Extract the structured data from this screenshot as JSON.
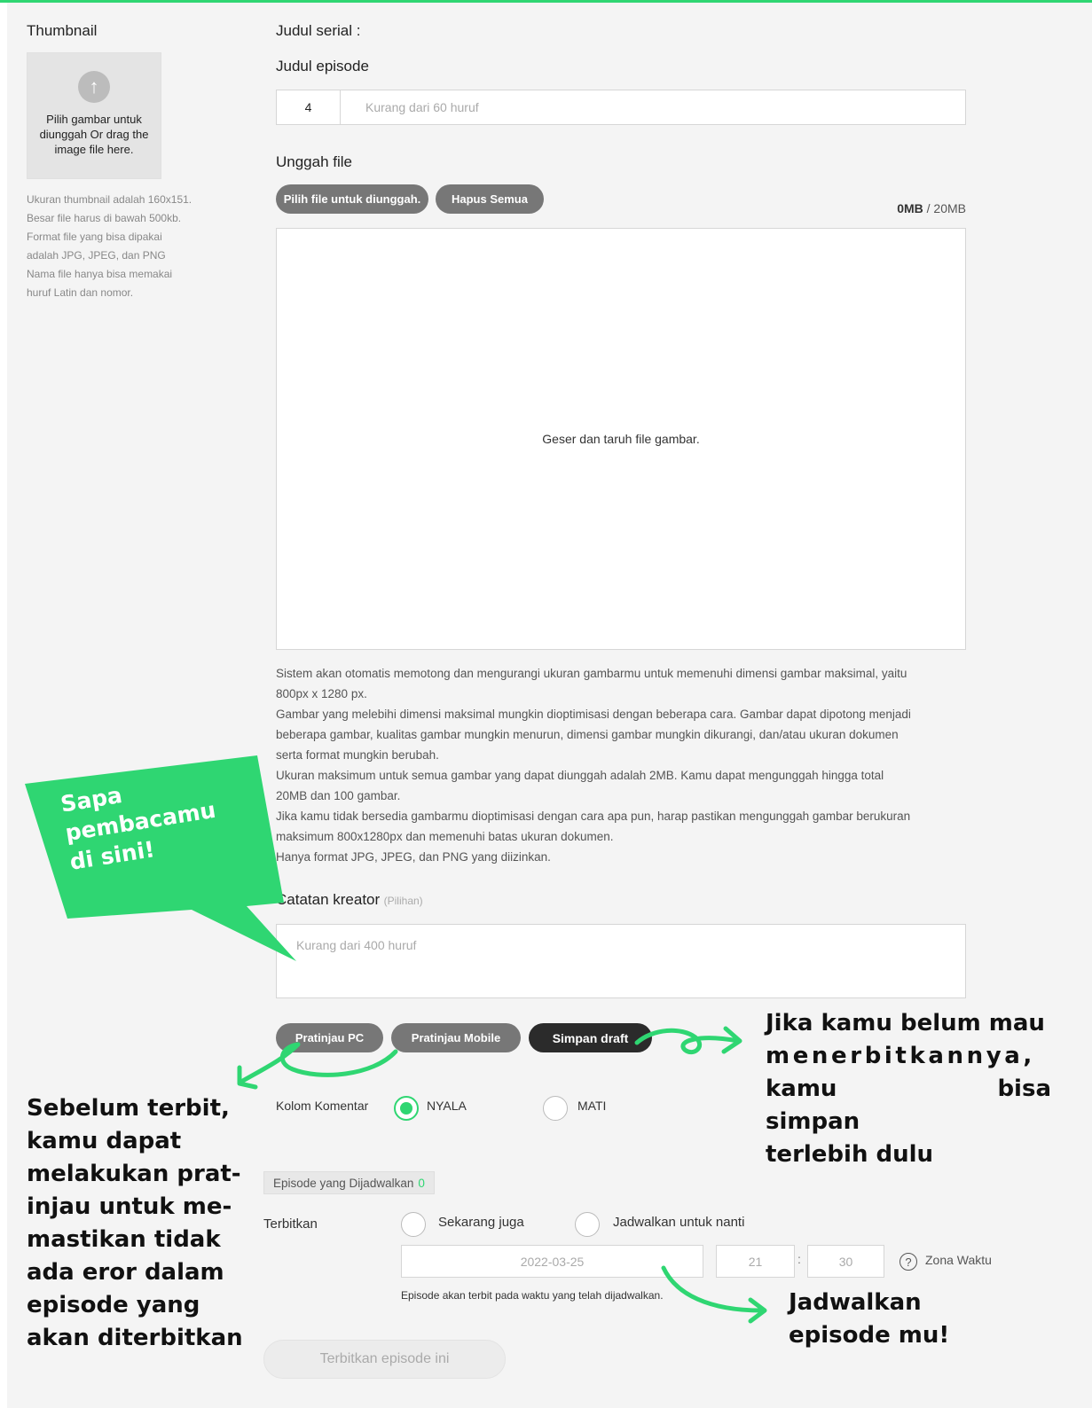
{
  "thumbnail": {
    "label": "Thumbnail",
    "upload_text": "Pilih gambar untuk diunggah Or drag the image file here.",
    "hints": [
      "Ukuran thumbnail adalah 160x151.",
      "Besar file harus di bawah 500kb.",
      "Format file yang bisa dipakai",
      "adalah JPG, JPEG, dan PNG",
      "Nama file hanya bisa memakai",
      "huruf Latin dan nomor."
    ]
  },
  "series": {
    "label": "Judul serial :"
  },
  "episode": {
    "label": "Judul episode",
    "number": "4",
    "title_placeholder": "Kurang dari 60 huruf"
  },
  "upload": {
    "label": "Unggah file",
    "choose_button": "Pilih file untuk diunggah.",
    "delete_all_button": "Hapus Semua",
    "size_used": "0MB",
    "size_limit": " / 20MB",
    "dropzone_text": "Geser dan taruh file gambar.",
    "info_lines": [
      "Sistem akan otomatis memotong dan mengurangi ukuran gambarmu untuk memenuhi dimensi gambar maksimal, yaitu",
      "800px x 1280 px.",
      "Gambar yang melebihi dimensi maksimal mungkin dioptimisasi dengan beberapa cara. Gambar dapat dipotong menjadi",
      "beberapa gambar, kualitas gambar mungkin menurun, dimensi gambar mungkin dikurangi, dan/atau ukuran dokumen",
      "serta format mungkin berubah.",
      "Ukuran maksimum untuk semua gambar yang dapat diunggah adalah 2MB. Kamu dapat mengunggah hingga total",
      "20MB dan 100 gambar.",
      "Jika kamu tidak bersedia gambarmu dioptimisasi dengan cara apa pun, harap pastikan mengunggah gambar berukuran",
      "maksimum 800x1280px dan memenuhi batas ukuran dokumen.",
      "Hanya format JPG, JPEG, dan PNG yang diizinkan."
    ]
  },
  "creator_note": {
    "label": "Catatan kreator",
    "optional": "(Pilihan)",
    "placeholder": "Kurang dari 400 huruf"
  },
  "actions": {
    "preview_pc": "Pratinjau PC",
    "preview_mobile": "Pratinjau Mobile",
    "save_draft": "Simpan draft"
  },
  "comments": {
    "label": "Kolom Komentar",
    "on": "NYALA",
    "off": "MATI",
    "selected": "on"
  },
  "schedule": {
    "tag": "Episode yang Dijadwalkan",
    "count": "0",
    "publish_label": "Terbitkan",
    "now": "Sekarang juga",
    "later": "Jadwalkan untuk nanti",
    "date": "2022-03-25",
    "hour": "21",
    "minute": "30",
    "separator": ":",
    "timezone": "Zona Waktu",
    "note": "Episode akan terbit pada waktu yang telah dijadwalkan."
  },
  "publish_button": "Terbitkan episode ini",
  "annotations": {
    "bubble": [
      "Sapa",
      "pembacamu",
      "di sini!"
    ],
    "preview": [
      "Sebelum terbit,",
      "kamu dapat",
      "melakukan prat-",
      "injau untuk me-",
      "mastikan tidak",
      "ada eror dalam",
      "episode yang",
      "akan diterbitkan"
    ],
    "draft": [
      "Jika kamu belum mau",
      "menerbitkannya,",
      "kamu bisa simpan",
      "terlebih dulu"
    ],
    "schedule": [
      "Jadwalkan",
      "episode mu!"
    ]
  },
  "colors": {
    "accent": "#2fd672",
    "background": "#f4f4f4",
    "pill": "#777777",
    "dark_pill": "#2b2b2b"
  }
}
